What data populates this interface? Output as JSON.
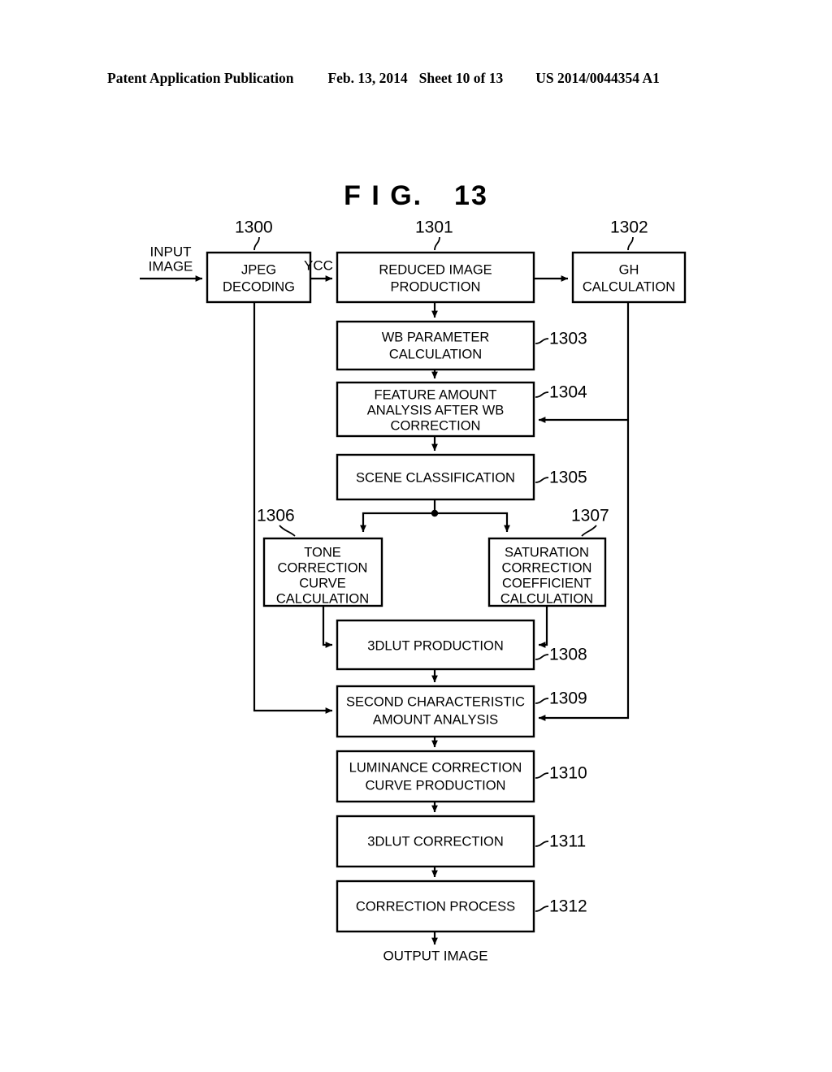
{
  "header": {
    "publication": "Patent Application Publication",
    "date": "Feb. 13, 2014",
    "sheet": "Sheet 10 of 13",
    "patent_number": "US 2014/0044354 A1"
  },
  "figure": {
    "title_prefix": "F I G.",
    "title_number": "13"
  },
  "io": {
    "input_label_line1": "INPUT",
    "input_label_line2": "IMAGE",
    "ycc_label": "YCC",
    "output_label": "OUTPUT IMAGE"
  },
  "blocks": {
    "b1300": {
      "ref": "1300",
      "line1": "JPEG",
      "line2": "DECODING"
    },
    "b1301": {
      "ref": "1301",
      "line1": "REDUCED IMAGE",
      "line2": "PRODUCTION"
    },
    "b1302": {
      "ref": "1302",
      "line1": "GH",
      "line2": "CALCULATION"
    },
    "b1303": {
      "ref": "1303",
      "line1": "WB PARAMETER",
      "line2": "CALCULATION"
    },
    "b1304": {
      "ref": "1304",
      "line1": "FEATURE AMOUNT",
      "line2": "ANALYSIS AFTER WB",
      "line3": "CORRECTION"
    },
    "b1305": {
      "ref": "1305",
      "line1": "SCENE CLASSIFICATION"
    },
    "b1306": {
      "ref": "1306",
      "line1": "TONE",
      "line2": "CORRECTION",
      "line3": "CURVE",
      "line4": "CALCULATION"
    },
    "b1307": {
      "ref": "1307",
      "line1": "SATURATION",
      "line2": "CORRECTION",
      "line3": "COEFFICIENT",
      "line4": "CALCULATION"
    },
    "b1308": {
      "ref": "1308",
      "line1": "3DLUT PRODUCTION"
    },
    "b1309": {
      "ref": "1309",
      "line1": "SECOND CHARACTERISTIC",
      "line2": "AMOUNT ANALYSIS"
    },
    "b1310": {
      "ref": "1310",
      "line1": "LUMINANCE CORRECTION",
      "line2": "CURVE PRODUCTION"
    },
    "b1311": {
      "ref": "1311",
      "line1": "3DLUT CORRECTION"
    },
    "b1312": {
      "ref": "1312",
      "line1": "CORRECTION PROCESS"
    }
  },
  "colors": {
    "ink": "#000000",
    "paper": "#ffffff"
  }
}
